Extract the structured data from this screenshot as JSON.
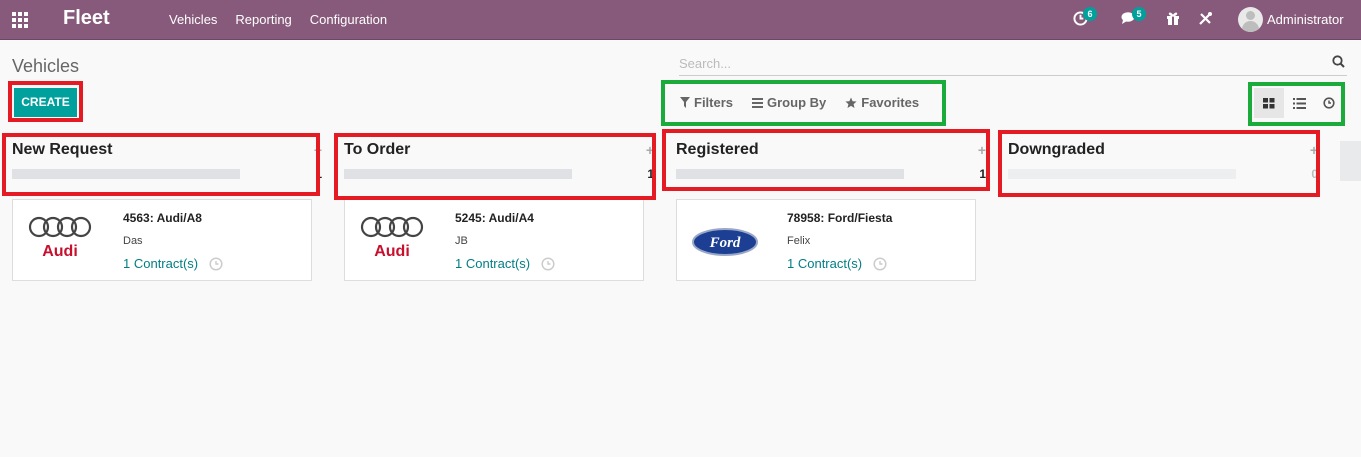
{
  "navbar": {
    "app_name": "Fleet",
    "menu": [
      "Vehicles",
      "Reporting",
      "Configuration"
    ],
    "activity_count": "6",
    "messages_count": "5",
    "user_name": "Administrator"
  },
  "control_panel": {
    "breadcrumb": "Vehicles",
    "create_label": "CREATE",
    "search_placeholder": "Search...",
    "filters_label": "Filters",
    "group_by_label": "Group By",
    "favorites_label": "Favorites",
    "view_switcher": [
      "kanban-icon",
      "list-icon",
      "activity-icon"
    ]
  },
  "kanban": {
    "columns": [
      {
        "title": "New Request",
        "count": "1",
        "progress": 1,
        "cards": [
          {
            "title": "4563: Audi/A8",
            "driver": "Das",
            "contracts": "1 Contract(s)",
            "brand": "audi"
          }
        ]
      },
      {
        "title": "To Order",
        "count": "1",
        "progress": 1,
        "cards": [
          {
            "title": "5245: Audi/A4",
            "driver": "JB",
            "contracts": "1 Contract(s)",
            "brand": "audi"
          }
        ]
      },
      {
        "title": "Registered",
        "count": "1",
        "progress": 1,
        "cards": [
          {
            "title": "78958: Ford/Fiesta",
            "driver": "Felix",
            "contracts": "1 Contract(s)",
            "brand": "ford"
          }
        ]
      },
      {
        "title": "Downgraded",
        "count": "0",
        "progress": 0,
        "cards": []
      }
    ]
  },
  "colors": {
    "navbar": "#875a7b",
    "primary": "#00a09d",
    "link": "#017e84",
    "highlight_red": "#e51b24",
    "highlight_green": "#1bab3a"
  }
}
